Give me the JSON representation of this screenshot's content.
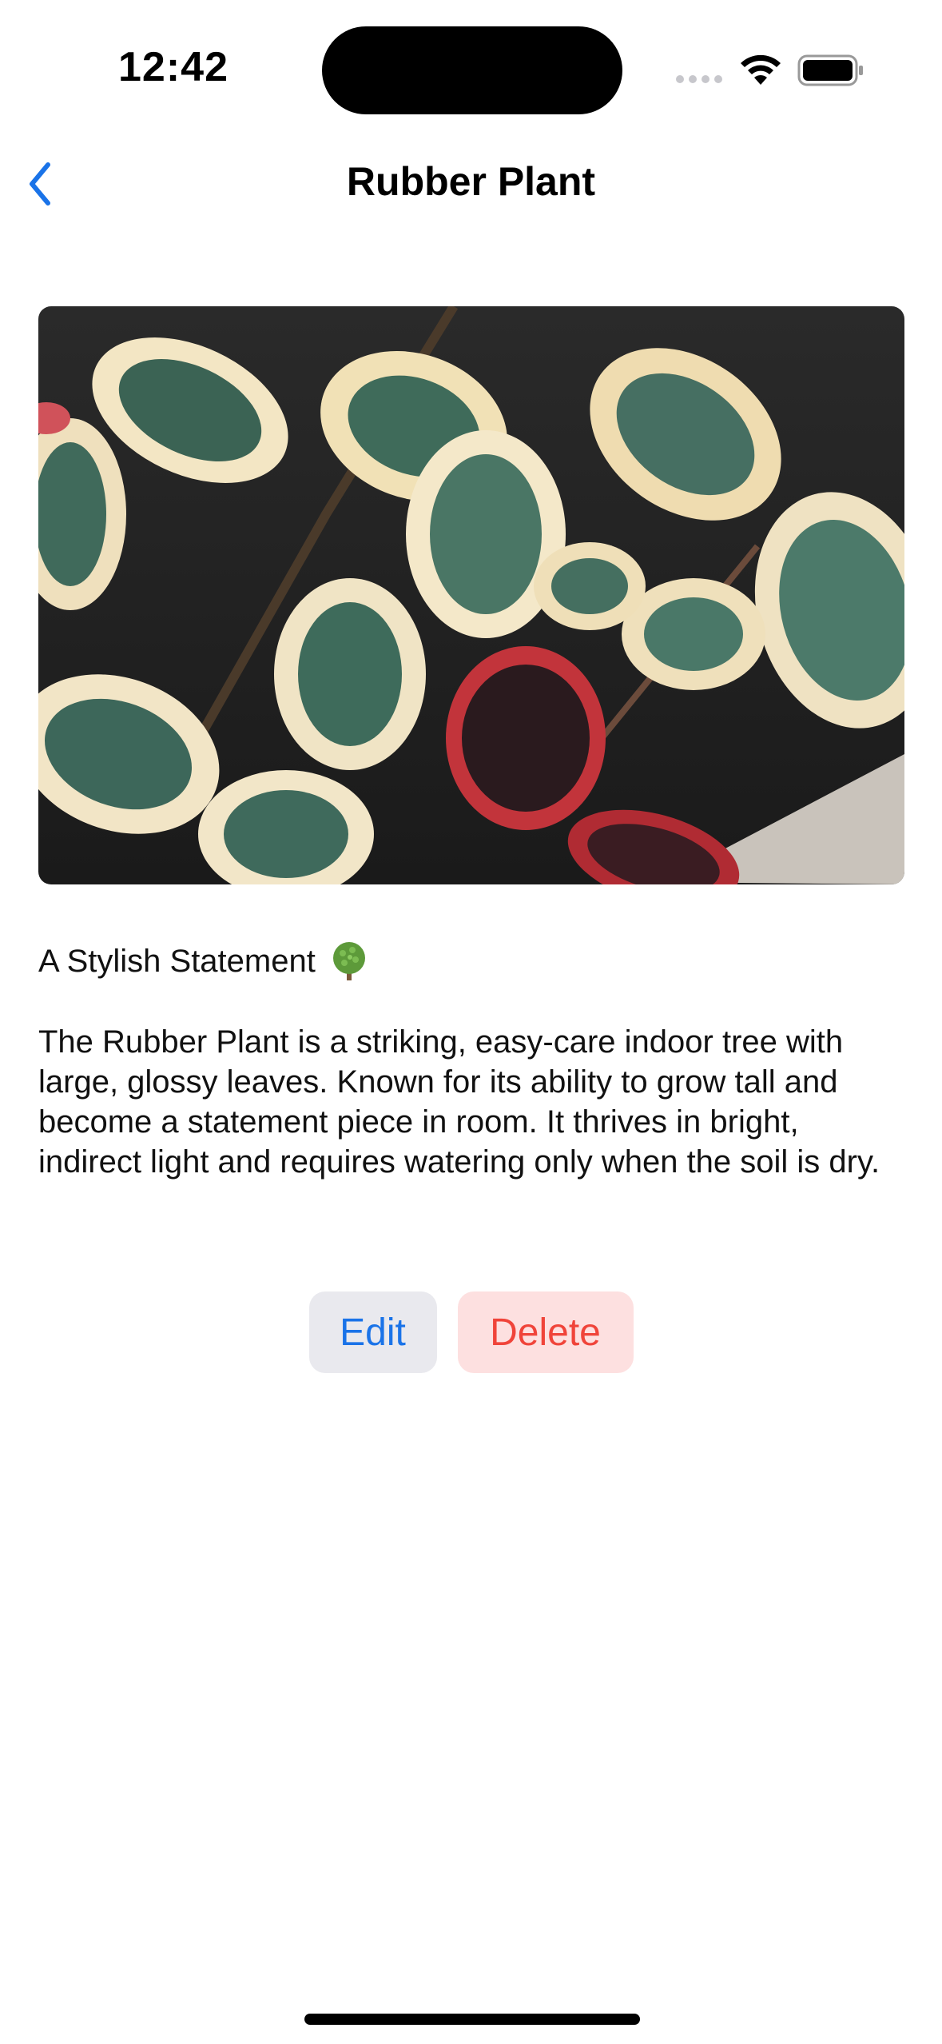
{
  "status_bar": {
    "time": "12:42"
  },
  "nav": {
    "title": "Rubber Plant",
    "back_icon": "chevron-left-icon"
  },
  "plant": {
    "subtitle": "A Stylish Statement",
    "subtitle_emoji": "tree-emoji",
    "description": "The Rubber Plant is a striking, easy-care indoor tree with large, glossy leaves. Known for its ability to grow tall and become a statement piece in room. It thrives in bright, indirect light and requires watering only when the soil is dry."
  },
  "actions": {
    "edit_label": "Edit",
    "delete_label": "Delete"
  },
  "colors": {
    "accent": "#1a73e8",
    "destructive": "#f0443a"
  }
}
